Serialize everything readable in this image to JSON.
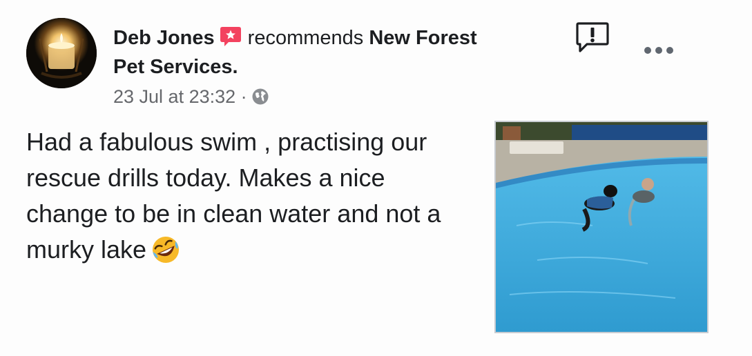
{
  "post": {
    "author_name": "Deb Jones",
    "action_text": "recommends",
    "page_name_part1": "New Forest",
    "page_name_part2": "Pet Services.",
    "timestamp": "23 Jul at 23:32",
    "separator": "·",
    "audience_icon": "globe-icon",
    "recommendation_icon": "recommendation-star-icon",
    "body_text": "Had a fabulous swim , practising our rescue drills today.  Makes a nice change to be in clean water and not a murky lake",
    "emoji": "rolling-on-floor-laughing-emoji",
    "photo_subject": "dog-swimming-in-pool-photo"
  },
  "colors": {
    "recommendation_badge": "#f3425f",
    "meta_text": "#65676b",
    "pool_water": "#3ea8d8"
  }
}
